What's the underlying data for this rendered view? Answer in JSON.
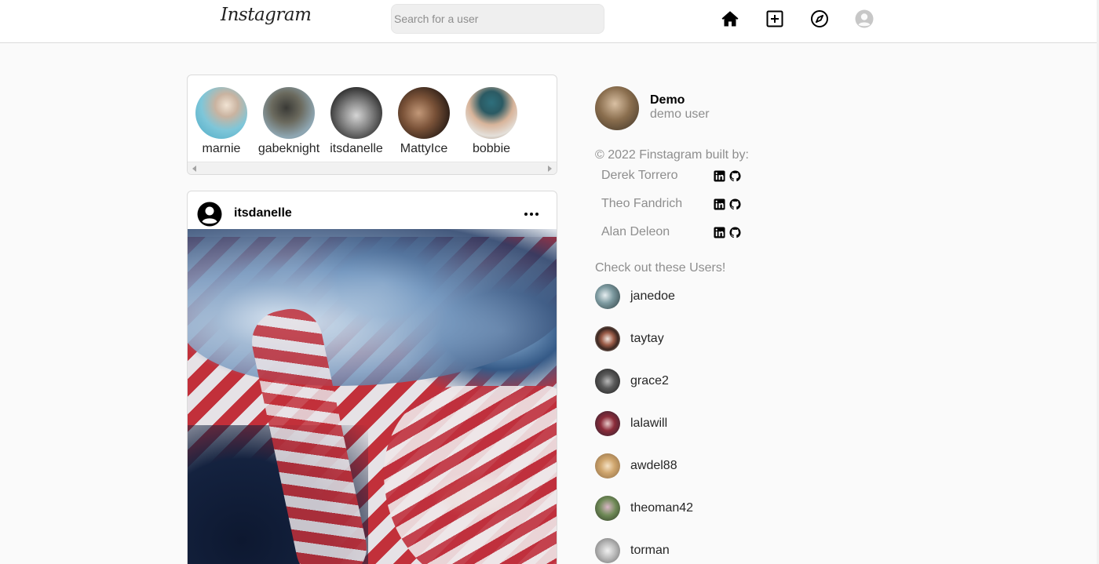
{
  "header": {
    "logo": "Instagram",
    "search_placeholder": "Search for a user",
    "nav_icons": [
      "home-icon",
      "new-post-icon",
      "explore-icon",
      "profile-icon"
    ]
  },
  "stories": [
    {
      "name": "marnie"
    },
    {
      "name": "gabeknight"
    },
    {
      "name": "itsdanelle"
    },
    {
      "name": "MattyIce"
    },
    {
      "name": "bobbie"
    }
  ],
  "post": {
    "username": "itsdanelle",
    "options_icon": "more-horizontal-icon"
  },
  "profile": {
    "username": "Demo",
    "full_name": "demo user"
  },
  "credits": {
    "text": "© 2022 Finstagram built by:",
    "authors": [
      {
        "name": "Derek Torrero"
      },
      {
        "name": "Theo Fandrich"
      },
      {
        "name": "Alan Deleon"
      }
    ]
  },
  "suggestions": {
    "heading": "Check out these Users!",
    "users": [
      {
        "name": "janedoe"
      },
      {
        "name": "taytay"
      },
      {
        "name": "grace2"
      },
      {
        "name": "lalawill"
      },
      {
        "name": "awdel88"
      },
      {
        "name": "theoman42"
      },
      {
        "name": "torman"
      }
    ]
  },
  "colors": {
    "background": "#fafafa",
    "border": "#dbdbdb",
    "secondary_text": "#8e8e8e"
  }
}
